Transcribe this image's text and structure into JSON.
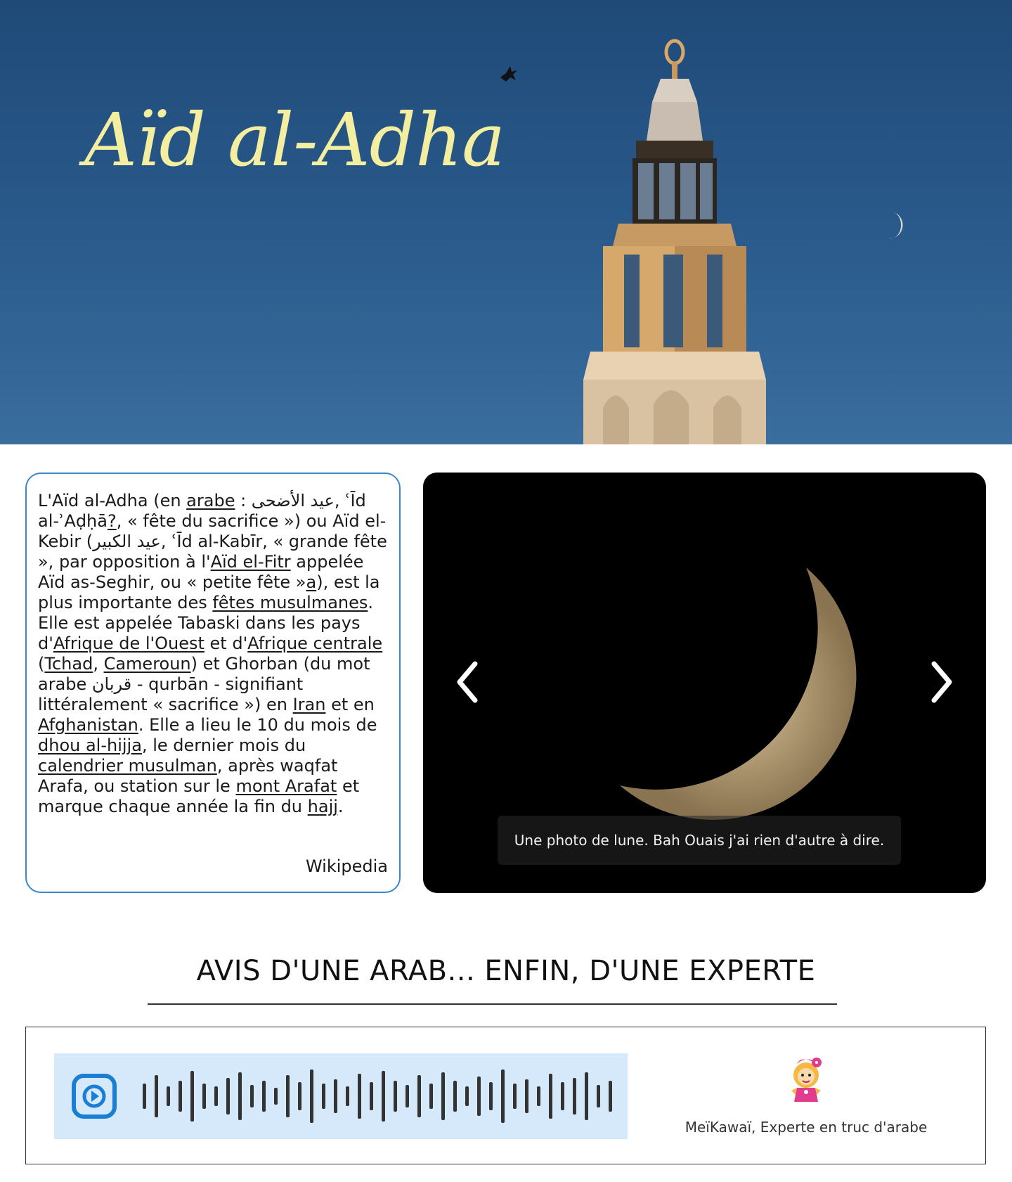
{
  "hero": {
    "title": "Aïd al-Adha"
  },
  "info": {
    "segments": [
      {
        "t": "L'Aïd al-Adha (en "
      },
      {
        "t": "arabe",
        "link": true
      },
      {
        "t": " : عيد الأضحى, ʿĪd al-ʾAḍḥā"
      },
      {
        "t": "?",
        "link": true
      },
      {
        "t": ", « fête du sacrifice ») ou Aïd el-Kebir (عيد الكبير, ʿĪd al-Kabīr, « grande fête », par opposition à l'"
      },
      {
        "t": "Aïd el-Fitr",
        "link": true
      },
      {
        "t": " appelée Aïd as-Seghir, ou « petite fête »"
      },
      {
        "t": "a",
        "link": true
      },
      {
        "t": "), est la plus importante des "
      },
      {
        "t": "fêtes musulmanes",
        "link": true
      },
      {
        "t": ". Elle est appelée Tabaski dans les pays d'"
      },
      {
        "t": "Afrique de l'Ouest",
        "link": true
      },
      {
        "t": " et d'"
      },
      {
        "t": "Afrique centrale",
        "link": true
      },
      {
        "t": " ("
      },
      {
        "t": "Tchad",
        "link": true
      },
      {
        "t": ", "
      },
      {
        "t": "Cameroun",
        "link": true
      },
      {
        "t": ") et Ghorban (du mot arabe قربان - qurbān - signifiant littéralement « sacrifice ») en "
      },
      {
        "t": "Iran",
        "link": true
      },
      {
        "t": " et en "
      },
      {
        "t": "Afghanistan",
        "link": true
      },
      {
        "t": ". Elle a lieu le 10 du mois de "
      },
      {
        "t": "dhou al-hijja",
        "link": true
      },
      {
        "t": ", le dernier mois du "
      },
      {
        "t": "calendrier musulman",
        "link": true
      },
      {
        "t": ", après waqfat Arafa, ou station sur le "
      },
      {
        "t": "mont Arafat",
        "link": true
      },
      {
        "t": " et marque chaque année la fin du "
      },
      {
        "t": "hajj",
        "link": true
      },
      {
        "t": "."
      }
    ],
    "source": "Wikipedia"
  },
  "carousel": {
    "caption": "Une photo de lune. Bah Ouais j'ai rien d'autre à dire.",
    "prev_icon": "chevron-left-icon",
    "next_icon": "chevron-right-icon"
  },
  "review": {
    "heading": "AVIS D'UNE ARAB... ENFIN, D'UNE EXPERTE",
    "play_icon": "play-icon",
    "expert_name": "MeïKawaï, Experte en truc d'arabe"
  },
  "colors": {
    "hero_sky": "#2a5b8c",
    "title_yellow": "#f4eea0",
    "card_border": "#3b87c8",
    "player_bg": "#d6e9fb",
    "play_blue": "#1a7fd4"
  }
}
